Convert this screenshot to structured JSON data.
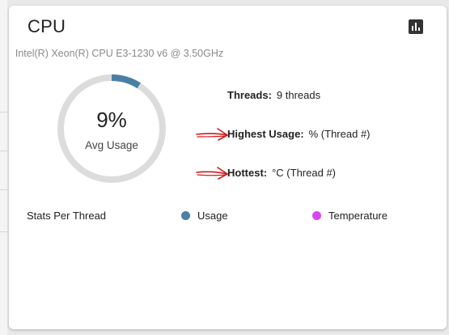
{
  "card": {
    "title": "CPU",
    "chart_button_icon": "bar-chart-icon",
    "cpu_model": "Intel(R) Xeon(R) CPU E3-1230 v6 @ 3.50GHz"
  },
  "gauge": {
    "percent_text": "9%",
    "label": "Avg Usage",
    "fraction": 0.09,
    "colors": {
      "fill": "#4a80a6",
      "track": "#dcdcdc"
    }
  },
  "stats": {
    "threads_label": "Threads:",
    "threads_value": "9 threads",
    "highest_label": "Highest Usage:",
    "highest_value": "%  (Thread #)",
    "hottest_label": "Hottest:",
    "hottest_value": "°C  (Thread #)"
  },
  "legend": {
    "title": "Stats Per Thread",
    "items": [
      {
        "label": "Usage",
        "color": "#4a80a6"
      },
      {
        "label": "Temperature",
        "color": "#d946ef"
      }
    ]
  },
  "annotations": {
    "arrow_color": "#d11a1a"
  }
}
